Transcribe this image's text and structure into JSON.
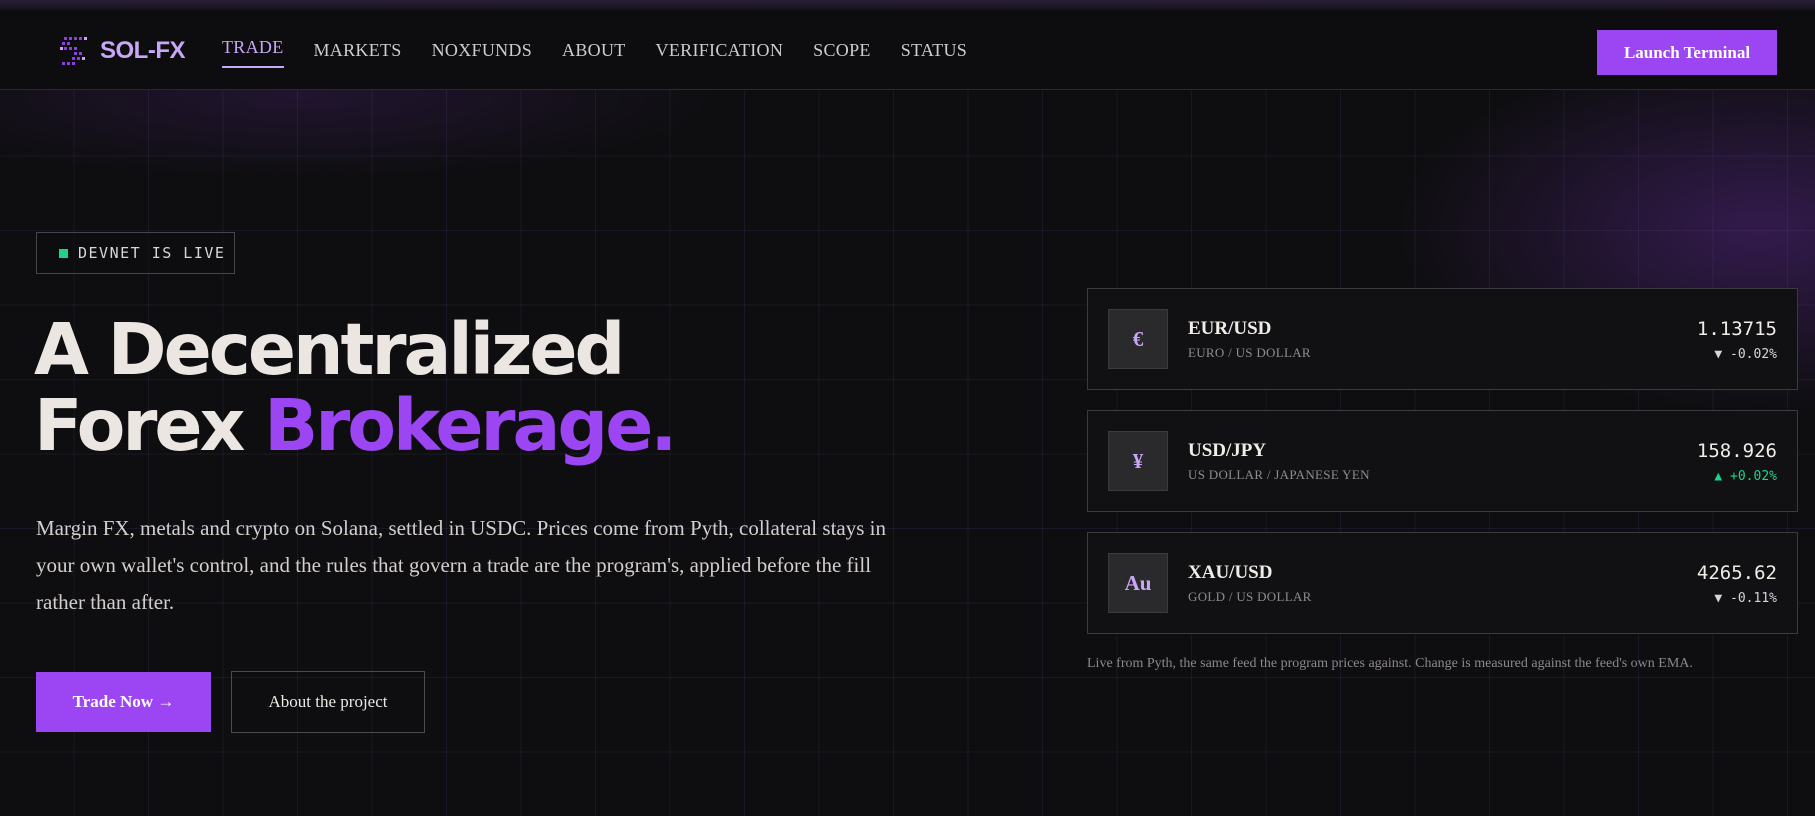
{
  "brand": {
    "name": "SOL-FX",
    "icon": "solana-dots-logo-icon",
    "accent_color": "#9b45f3",
    "logo_color": "#c9a7f7"
  },
  "nav": {
    "links": [
      {
        "label": "TRADE",
        "active": true
      },
      {
        "label": "MARKETS",
        "active": false
      },
      {
        "label": "NOXFUNDS",
        "active": false
      },
      {
        "label": "ABOUT",
        "active": false
      },
      {
        "label": "VERIFICATION",
        "active": false
      },
      {
        "label": "SCOPE",
        "active": false
      },
      {
        "label": "STATUS",
        "active": false
      }
    ],
    "cta_label": "Launch Terminal"
  },
  "hero": {
    "badge": {
      "text": "DEVNET IS LIVE",
      "status_color": "#1fd18a"
    },
    "headline_line1": "A Decentralized",
    "headline_line2_plain": "Forex ",
    "headline_line2_accent": "Brokerage.",
    "description": "Margin FX, metals and crypto on Solana, settled in USDC. Prices come from Pyth, collateral stays in your own wallet's control, and the rules that govern a trade are the program's, applied before the fill rather than after.",
    "primary_button": "Trade Now →",
    "secondary_button": "About the project"
  },
  "rates": {
    "items": [
      {
        "symbol": "€",
        "pair": "EUR/USD",
        "name": "EURO / US DOLLAR",
        "price": "1.13715",
        "change": "▼ -0.02%",
        "direction": "down"
      },
      {
        "symbol": "¥",
        "pair": "USD/JPY",
        "name": "US DOLLAR / JAPANESE YEN",
        "price": "158.926",
        "change": "▲ +0.02%",
        "direction": "up"
      },
      {
        "symbol": "Au",
        "pair": "XAU/USD",
        "name": "GOLD / US DOLLAR",
        "price": "4265.62",
        "change": "▼ -0.11%",
        "direction": "down"
      }
    ],
    "note": "Live from Pyth, the same feed the program prices against. Change is measured against the feed's own EMA.",
    "up_color": "#1fd18a"
  }
}
